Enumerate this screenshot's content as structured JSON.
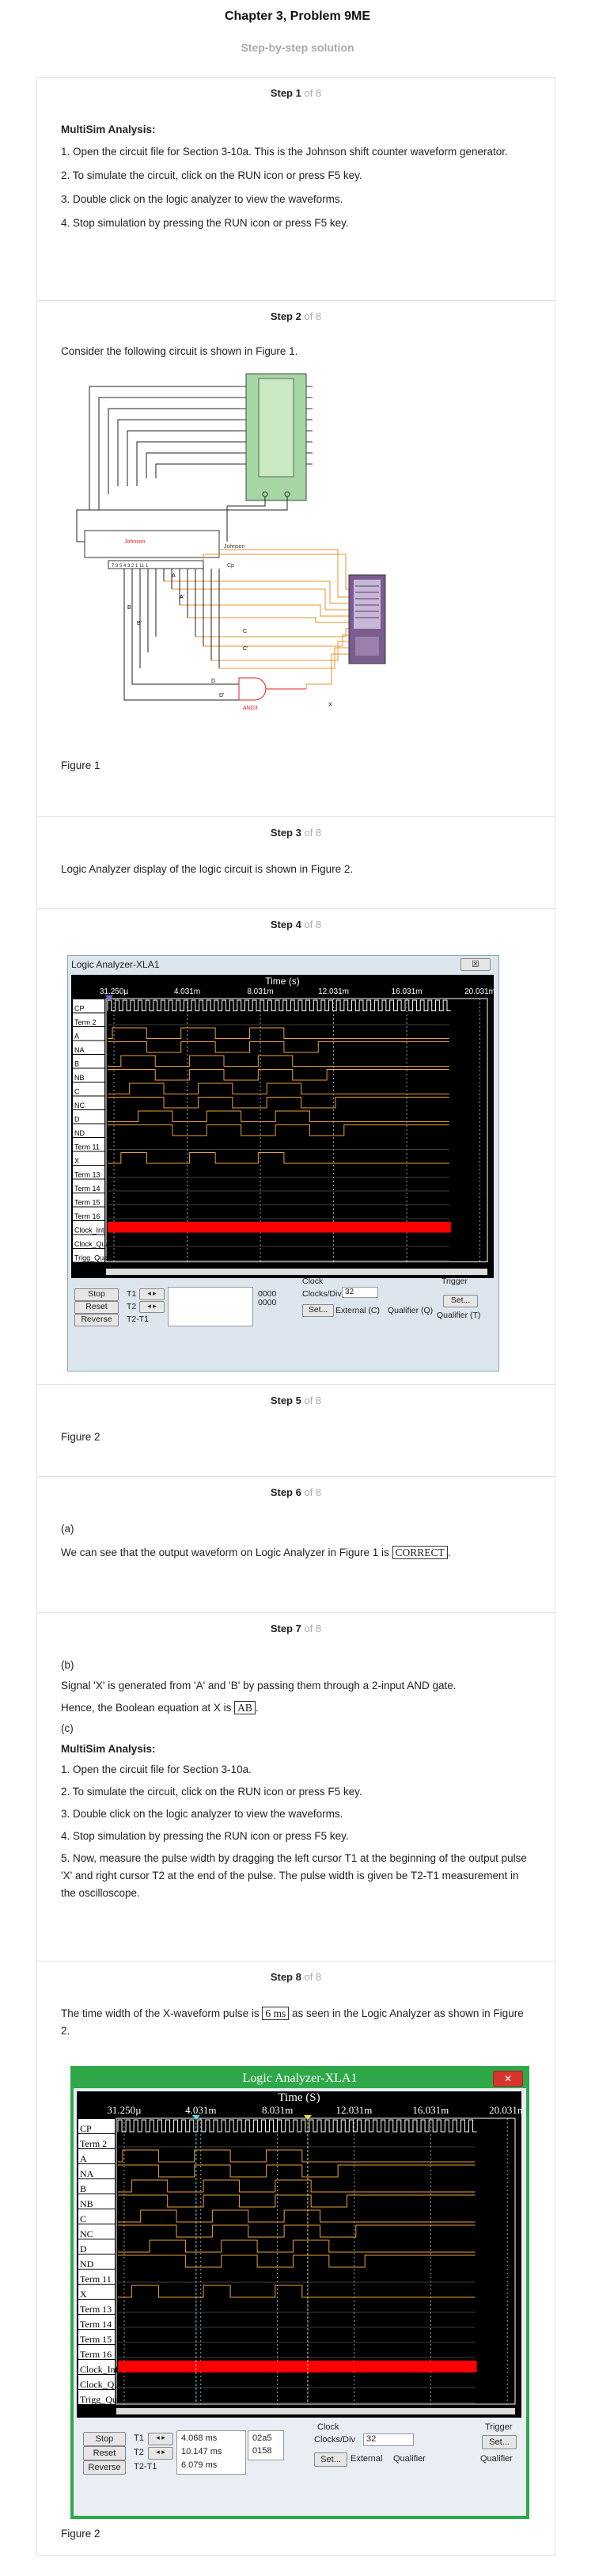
{
  "header": {
    "title": "Chapter 3, Problem 9ME",
    "subtitle": "Step-by-step solution"
  },
  "steps": [
    {
      "n": "Step 1",
      "of": "of 8"
    },
    {
      "n": "Step 2",
      "of": "of 8"
    },
    {
      "n": "Step 3",
      "of": "of 8"
    },
    {
      "n": "Step 4",
      "of": "of 8"
    },
    {
      "n": "Step 5",
      "of": "of 8"
    },
    {
      "n": "Step 6",
      "of": "of 8"
    },
    {
      "n": "Step 7",
      "of": "of 8"
    },
    {
      "n": "Step 8",
      "of": "of 8"
    }
  ],
  "step1": {
    "heading": "MultiSim Analysis:",
    "items": [
      "1. Open the circuit file for Section 3-10a. This is the Johnson shift counter waveform generator.",
      "2. To simulate the circuit, click on the RUN icon or press F5 key.",
      "3. Double click on the logic analyzer to view the waveforms.",
      "4. Stop simulation by pressing the RUN icon or press F5 key."
    ]
  },
  "step2": {
    "text": "Consider the following circuit is shown in Figure 1.",
    "caption": "Figure 1",
    "labels": {
      "johnson1": "Johnson",
      "johnson2": "Johnson",
      "cp": "Cp",
      "and": "AND3",
      "A": "A",
      "Ap": "A'",
      "B": "B",
      "Bp": "B'",
      "C": "C",
      "Cp2": "C'",
      "D": "D",
      "Dp": "D'",
      "X": "X",
      "pins": "7 8 5 4 3 2 1 11 1"
    }
  },
  "step3": {
    "text": "Logic Analyzer display of the logic circuit is shown in Figure 2."
  },
  "step5": {
    "caption": "Figure 2"
  },
  "step6": {
    "part": "(a)",
    "text_before": "We can see that the output waveform on Logic Analyzer in Figure 1 is",
    "answer": "CORRECT",
    "text_after": "."
  },
  "step7": {
    "part_b": "(b)",
    "line1": "Signal 'X' is generated from 'A' and 'B' by passing them through a 2-input AND gate.",
    "line2_before": "Hence, the Boolean equation at X is",
    "answer": "AB",
    "line2_after": ".",
    "part_c": "(c)",
    "heading": "MultiSim Analysis:",
    "items": [
      "1. Open the circuit file for Section 3-10a.",
      "2. To simulate the circuit, click on the RUN icon or press F5 key.",
      "3. Double click on the logic analyzer to view the waveforms.",
      "4. Stop simulation by pressing the RUN icon or press F5 key.",
      "5. Now, measure the pulse width by dragging the left cursor T1 at the beginning of the output pulse 'X' and right cursor T2 at the end of the pulse. The pulse width is given be T2-T1 measurement in the oscilloscope."
    ]
  },
  "step8": {
    "text_before": "The time width of the X-waveform pulse is",
    "answer": "6 ms",
    "text_after": "as seen in the Logic Analyzer as shown in Figure 2.",
    "caption": "Figure 2"
  },
  "la1": {
    "title": "Logic Analyzer-XLA1",
    "close": "☒",
    "time_label": "Time (s)",
    "ticks": [
      "31.250µ",
      "4.031m",
      "8.031m",
      "12.031m",
      "16.031m",
      "20.031m"
    ],
    "channels": [
      "CP",
      "Term 2",
      "A",
      "NA",
      "B",
      "NB",
      "C",
      "NC",
      "D",
      "ND",
      "Term 11",
      "X",
      "Term 13",
      "Term 14",
      "Term 15",
      "Term 16",
      "Clock_Int",
      "Clock_Qua",
      "Trigg_Qua"
    ],
    "buttons": {
      "stop": "Stop",
      "reset": "Reset",
      "reverse": "Reverse",
      "set1": "Set...",
      "set2": "Set..."
    },
    "t1": "T1",
    "t2": "T2",
    "t21": "T2-T1",
    "v1": "0000",
    "v2": "0000",
    "clock": "Clock",
    "clocks_div": "Clocks/Div",
    "clocks_val": "32",
    "trigger": "Trigger",
    "external": "External (C)",
    "qualifier": "Qualifier (Q)",
    "trig_qual": "Qualifier (T)"
  },
  "la2": {
    "title": "Logic Analyzer-XLA1",
    "close": "✕",
    "time_label": "Time (S)",
    "ticks": [
      "31.250µ",
      "4.031m",
      "8.031m",
      "12.031m",
      "16.031m",
      "20.031m"
    ],
    "channels": [
      "CP",
      "Term 2",
      "A",
      "NA",
      "B",
      "NB",
      "C",
      "NC",
      "D",
      "ND",
      "Term 11",
      "X",
      "Term 13",
      "Term 14",
      "Term 15",
      "Term 16",
      "Clock_Int",
      "Clock_Qua",
      "Trigg_Qua"
    ],
    "buttons": {
      "stop": "Stop",
      "reset": "Reset",
      "reverse": "Reverse",
      "set1": "Set...",
      "set2": "Set..."
    },
    "t1": "T1",
    "t2": "T2",
    "t21": "T2-T1",
    "t1v": "4.068 ms",
    "t2v": "10.147 ms",
    "t21v": "6.079 ms",
    "h1": "02a5",
    "h2": "0158",
    "clock": "Clock",
    "clocks_div": "Clocks/Div",
    "clocks_val": "32",
    "trigger": "Trigger",
    "external": "External",
    "qualifier": "Qualifier",
    "trig_qual": "Qualifier"
  },
  "colors": {
    "screen": "#000000",
    "wave": "#e8a23a",
    "clock_bar": "#ff0000",
    "titlebar2": "#2fa84a",
    "cursor1": "#5fd8e8",
    "cursor2": "#e8d84a"
  }
}
